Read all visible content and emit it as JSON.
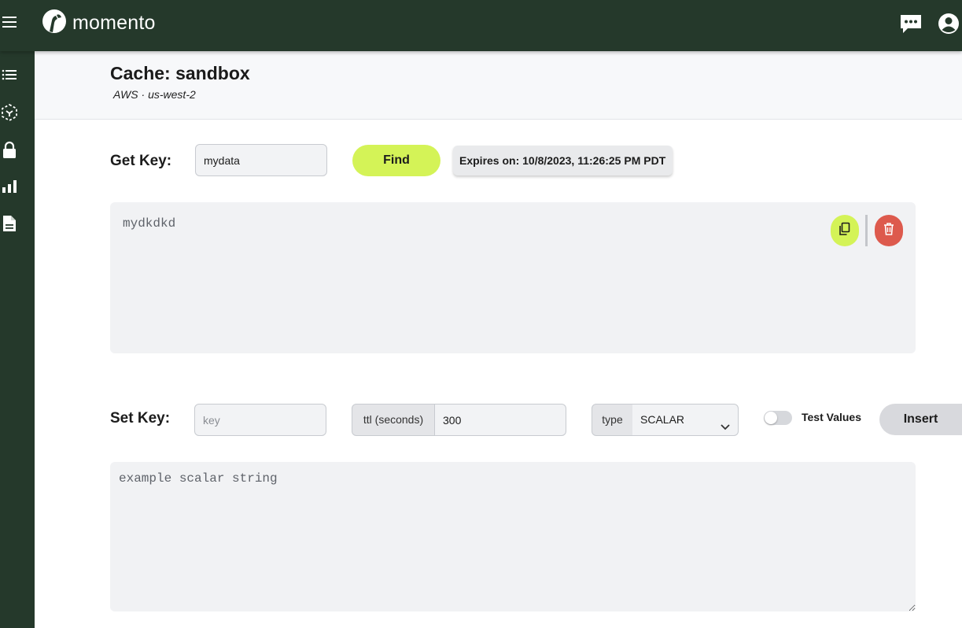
{
  "app": {
    "brand_name": "momento"
  },
  "icons": {
    "menu": "hamburger-menu-icon",
    "logo": "momento-logo-icon",
    "chat": "chat-bubble-icon",
    "account": "account-circle-icon",
    "sidebar": [
      "list-icon",
      "dashed-cube-icon",
      "lock-icon",
      "bar-chart-icon",
      "document-icon"
    ],
    "copy": "copy-icon",
    "delete": "trash-icon",
    "dropdown": "chevron-down-icon"
  },
  "header": {
    "title": "Cache: sandbox",
    "subtitle": "AWS · us-west-2"
  },
  "get_key": {
    "label": "Get Key:",
    "input_value": "mydata",
    "find_label": "Find",
    "expires_text": "Expires on: 10/8/2023, 11:26:25 PM PDT",
    "value_text": "mydkdkd"
  },
  "set_key": {
    "label": "Set Key:",
    "key_placeholder": "key",
    "key_value": "",
    "ttl_label": "ttl (seconds)",
    "ttl_value": "300",
    "type_label": "type",
    "type_selected": "SCALAR",
    "test_values_label": "Test Values",
    "test_values_on": false,
    "insert_label": "Insert",
    "value_placeholder": "example scalar string"
  },
  "colors": {
    "nav_bg": "#25392b",
    "accent_lime": "#d4f357",
    "danger_red": "#dd5a4d",
    "panel_bg": "#f1f2f4"
  }
}
